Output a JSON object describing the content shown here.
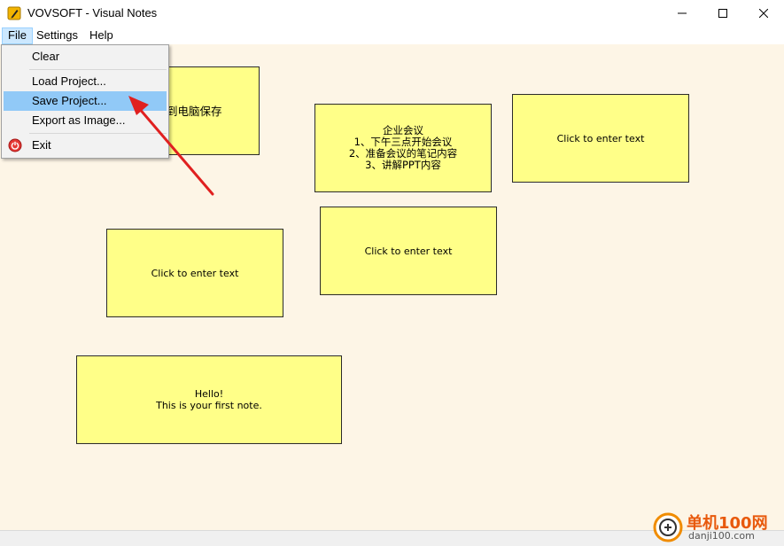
{
  "window": {
    "title": "VOVSOFT - Visual Notes",
    "controls": {
      "minimize": "minimize-icon",
      "maximize": "maximize-icon",
      "close": "close-icon"
    }
  },
  "menubar": {
    "file": "File",
    "settings": "Settings",
    "help": "Help"
  },
  "file_menu": {
    "clear": "Clear",
    "load": "Load Project...",
    "save": "Save Project...",
    "export": "Export as Image...",
    "exit": "Exit",
    "highlighted": "Save Project..."
  },
  "notes": [
    {
      "text": "到电脑保存"
    },
    {
      "text": "企业会议\n1、下午三点开始会议\n2、准备会议的笔记内容\n3、讲解PPT内容"
    },
    {
      "text": "Click to enter text"
    },
    {
      "text": "Click to enter text"
    },
    {
      "text": "Click to enter text"
    },
    {
      "text": "Hello!\nThis is your first note."
    }
  ],
  "colors": {
    "note_fill": "#ffff88",
    "canvas_bg": "#fdf5e6",
    "menu_highlight": "#91c9f7",
    "arrow": "#e02020"
  },
  "watermark": {
    "brand": "单机100网",
    "url": "danji100.com"
  }
}
